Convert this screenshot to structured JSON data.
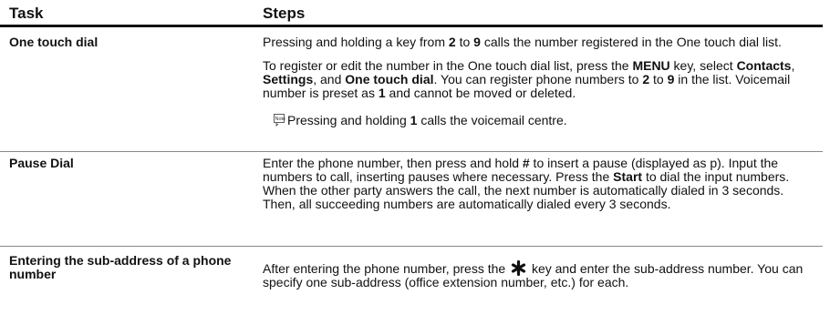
{
  "header": {
    "task": "Task",
    "steps": "Steps"
  },
  "rows": [
    {
      "task": "One touch dial",
      "steps": [
        [
          "Pressing and holding a key from ",
          {
            "b": "2"
          },
          " to ",
          {
            "b": "9"
          },
          " calls the number registered in the One touch dial list."
        ],
        [
          "To register or edit the number in the One touch dial list, press the ",
          {
            "b": "MENU"
          },
          " key, select ",
          {
            "b": "Contacts"
          },
          ", ",
          {
            "b": "Settings"
          },
          ", and ",
          {
            "b": "One touch dial"
          },
          ". You can register phone numbers to ",
          {
            "b": "2"
          },
          " to ",
          {
            "b": "9"
          },
          " in the list. Voicemail number is preset as ",
          {
            "b": "1"
          },
          " and cannot be moved or deleted."
        ]
      ],
      "note": [
        "Pressing and holding ",
        {
          "b": "1"
        },
        " calls the voicemail centre."
      ],
      "note_icon": "note-icon"
    },
    {
      "task": "Pause Dial",
      "steps": [
        [
          "Enter the phone number, then press and hold ",
          {
            "b": "#"
          },
          " to insert a pause (displayed as p). Input the numbers to call, inserting pauses where necessary. Press the ",
          {
            "b": "Start"
          },
          " to dial the input numbers. When the other party answers the call, the next number is automatically dialed in 3 seconds. Then, all succeeding numbers are automatically dialed every 3 seconds."
        ]
      ]
    },
    {
      "task": "Entering the sub-address of a phone number",
      "steps": [
        [
          "After entering the phone number, press the ",
          {
            "icon": "star-key-icon"
          },
          " key and enter the sub-address number. You can specify one sub-address (office extension number, etc.) for each."
        ]
      ]
    }
  ]
}
